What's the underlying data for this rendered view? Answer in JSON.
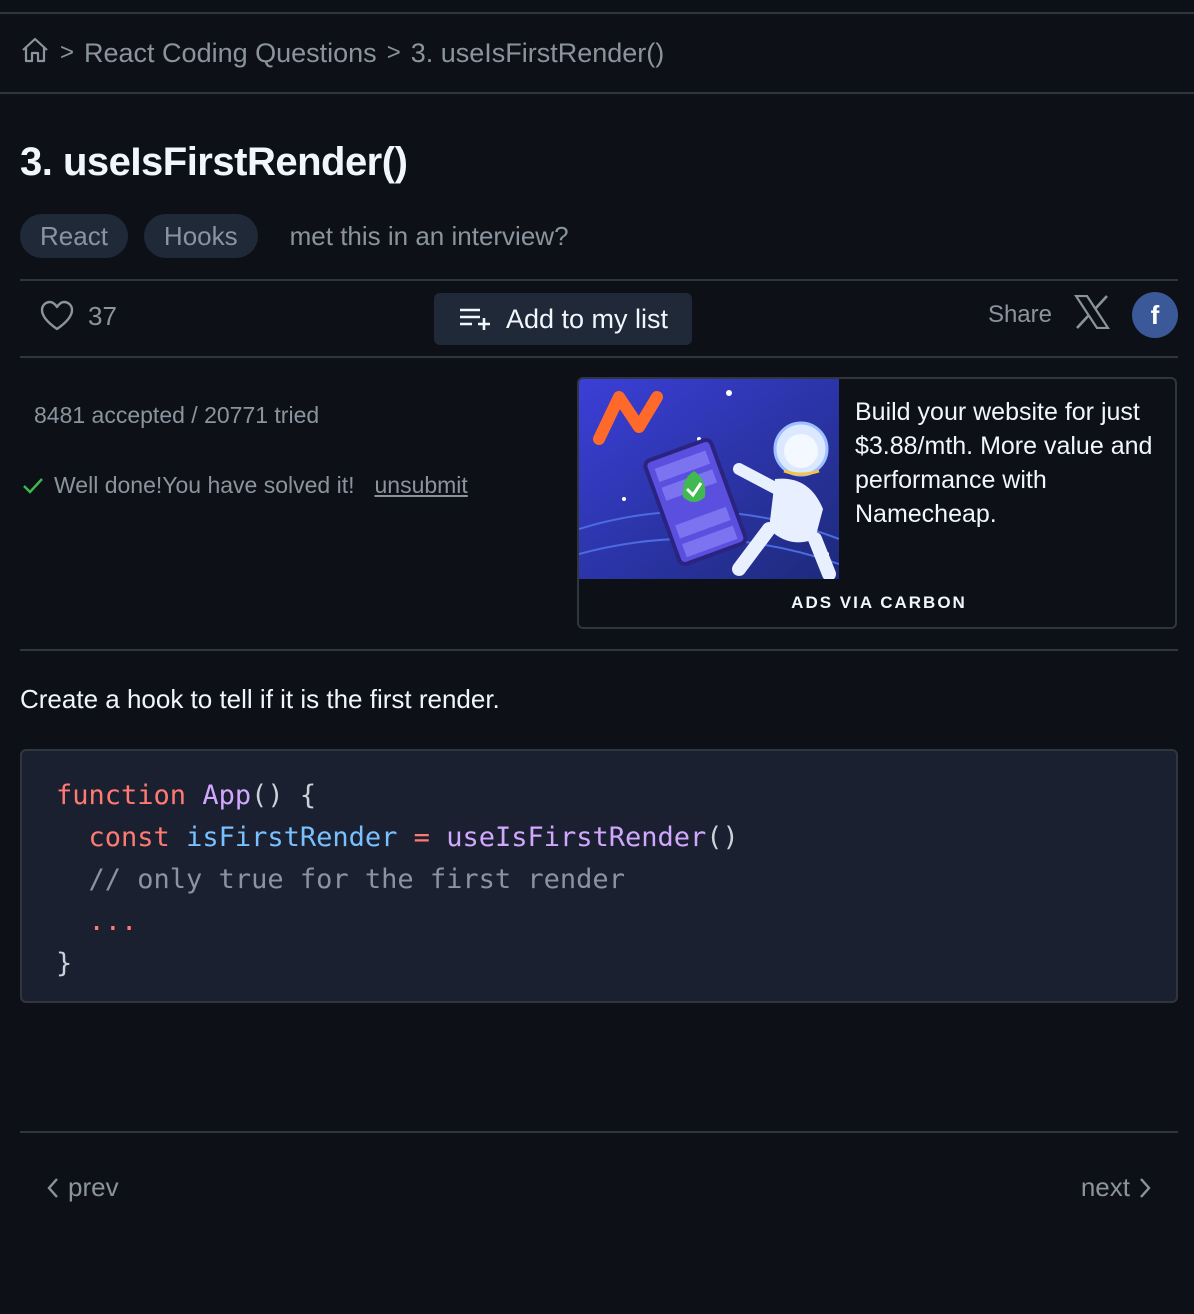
{
  "breadcrumb": {
    "home_icon": "home-icon",
    "section": "React Coding Questions",
    "current": "3. useIsFirstRender()",
    "separator": ">"
  },
  "question": {
    "title": "3. useIsFirstRender()",
    "tags": [
      "React",
      "Hooks"
    ],
    "met_prompt": "met this in an interview?"
  },
  "actions": {
    "like_count": "37",
    "add_list_label": "Add to my list",
    "share_label": "Share"
  },
  "stats": {
    "text": "8481 accepted / 20771 tried",
    "solved_text": "Well done!You have solved it!",
    "unsubmit_label": "unsubmit"
  },
  "ad": {
    "text": "Build your website for just $3.88/mth. More value and performance with Namecheap.",
    "via": "ADS VIA CARBON"
  },
  "description": "Create a hook to tell if it is the first render.",
  "code": {
    "line1_kw": "function",
    "line1_fn": "App",
    "line1_rest": "() {",
    "line2_kw": "const",
    "line2_var": "isFirstRender",
    "line2_op": "=",
    "line2_fn": "useIsFirstRender",
    "line2_rest": "()",
    "line3_comment": "// only true for the first render",
    "line4": "...",
    "line5": "}"
  },
  "pager": {
    "prev": "prev",
    "next": "next"
  },
  "colors": {
    "background": "#0d1117",
    "check": "#3fb950",
    "facebook": "#3b5998"
  }
}
